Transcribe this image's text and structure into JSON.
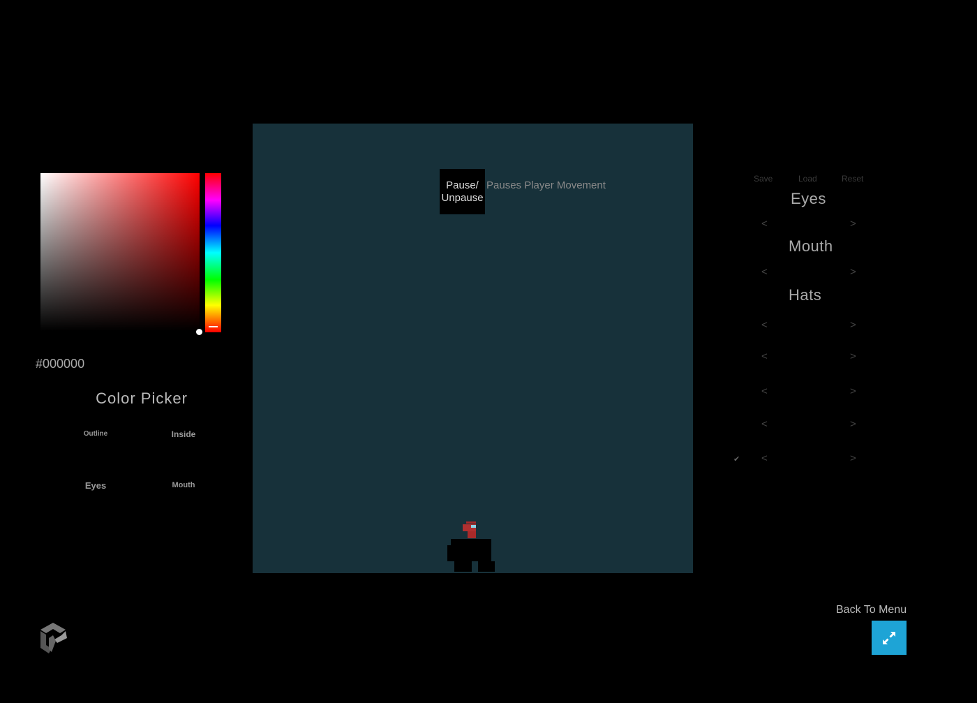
{
  "color_picker": {
    "hex_value": "#000000",
    "title": "Color Picker",
    "selected_hue_color": "#ff0000",
    "parts": {
      "outline": "Outline",
      "inside": "Inside",
      "eyes": "Eyes",
      "mouth": "Mouth"
    }
  },
  "viewport": {
    "background": "#17313a",
    "pause_button": "Pause/ Unpause",
    "pause_description": "Pauses Player Movement"
  },
  "customization": {
    "save": "Save",
    "load": "Load",
    "reset": "Reset",
    "sections": {
      "eyes": "Eyes",
      "mouth": "Mouth",
      "hats": "Hats"
    },
    "arrow_left": "<",
    "arrow_right": ">"
  },
  "footer": {
    "back_to_menu": "Back To Menu",
    "fullscreen_color": "#1ea4d6"
  }
}
